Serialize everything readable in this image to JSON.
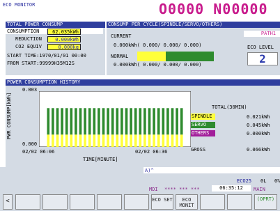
{
  "app": {
    "title": "ECO MONITOR",
    "counter": "O0000 N00000"
  },
  "total_power": {
    "header": "TOTAL POWER CONSUMP",
    "consumption_label": "CONSUMPTION",
    "consumption_value": "62.035kWh",
    "reduction_label": "REDUCTION",
    "reduction_value": "0.000kWh",
    "co2_label": "CO2 EQUIV",
    "co2_value": "0.000kg",
    "start_time": "START TIME:1970/01/01 00:00",
    "from_start": "FROM START:99999H35M12S"
  },
  "cycle": {
    "header": "CONSUMP PER CYCLE(SPINDLE/SERVO/OTHERS)",
    "current_label": "CURRENT",
    "current_values": "0.000kWh( 0.000/ 0.000/ 0.000)",
    "normal_label": "NORMAL",
    "normal_values": "0.000kWh( 0.000/ 0.000/ 0.000)",
    "normal_bar": {
      "spindle_fraction": 0.37,
      "servo_fraction": 0.63
    },
    "path_label": "PATH1",
    "eco_level_label": "ECO LEVEL",
    "eco_level_value": "2"
  },
  "history": {
    "header": "POWER CONSUMPTION HISTORY",
    "ylabel": "PWR CONSUMP[kWh]",
    "xlabel": "TIME[MINUTE]",
    "y_top_label": "0.003",
    "y_bottom_label": "0.000",
    "x_left_label": "02/02 06:06",
    "x_right_label": "02/02 06:36",
    "total_label": "TOTAL(30MIN)",
    "legend": [
      {
        "name": "SPINDLE",
        "value": "0.021kWh",
        "color": "#ffff3b"
      },
      {
        "name": "SERVO",
        "value": "0.045kWh",
        "color": "#2e8b2e"
      },
      {
        "name": "OTHERS",
        "value": "0.000kWh",
        "color": "#a21e9a"
      }
    ],
    "gross_label": "GROSS",
    "gross_value": "0.066kWh"
  },
  "chart_data": {
    "type": "bar",
    "stacked": true,
    "ylim": [
      0,
      0.003
    ],
    "bar_count": 30,
    "series": [
      {
        "name": "SPINDLE",
        "values": [
          0.0007,
          0.0007,
          0.0007,
          0.0007,
          0.0007,
          0.0007,
          0.0007,
          0.0007,
          0.0007,
          0.0007,
          0.0007,
          0.0007,
          0.0007,
          0.0007,
          0.0007,
          0.0007,
          0.0007,
          0.0007,
          0.0007,
          0.0007,
          0.0007,
          0.0007,
          0.0007,
          0.0007,
          0.0007,
          0.0007,
          0.0007,
          0.0007,
          0.0007,
          0.0007
        ]
      },
      {
        "name": "SERVO",
        "values": [
          0.0015,
          0.0015,
          0.0015,
          0.0015,
          0.0015,
          0.0015,
          0.0015,
          0.0015,
          0.0015,
          0.0015,
          0.0015,
          0.0015,
          0.0015,
          0.0015,
          0.0015,
          0.0015,
          0.0015,
          0.0015,
          0.0015,
          0.0015,
          0.0015,
          0.0015,
          0.0015,
          0.0015,
          0.0015,
          0.0015,
          0.0015,
          0.0015,
          0.0015,
          0.0015
        ]
      }
    ],
    "colors": {
      "spindle": "#ffff3b",
      "servo": "#2e8b2e"
    }
  },
  "status": {
    "prompt": "A)^",
    "eco_label": "ECO25",
    "zero_label": "0L",
    "extra_label": "0%",
    "mode": "MDI",
    "stars": "**** *** ***",
    "clock": "06:35:12",
    "main_label": "MAIN"
  },
  "softkeys": {
    "left_arrow": "<",
    "eco_set": "ECO SET",
    "eco_monit": "ECO MONIT",
    "oprt": "(OPRT)",
    "right_arrow": ">"
  }
}
